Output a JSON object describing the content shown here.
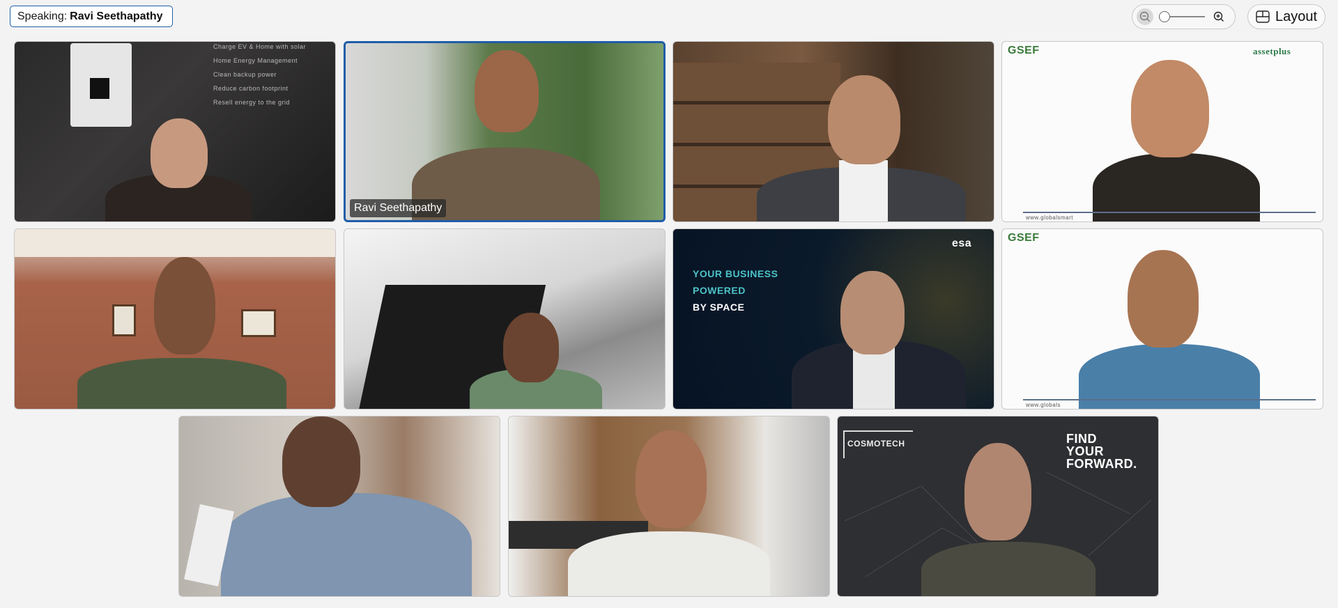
{
  "header": {
    "speaking_prefix": "Speaking:",
    "speaking_name": "Ravi Seethapathy",
    "layout_label": "Layout"
  },
  "tiles": [
    {
      "id": "tile-1",
      "label": "",
      "overlay": [
        "Charge EV & Home with solar",
        "Home Energy Management",
        "Clean backup power",
        "Reduce carbon footprint",
        "Resell energy to the grid"
      ]
    },
    {
      "id": "tile-2",
      "label": "Ravi Seethapathy",
      "active": true
    },
    {
      "id": "tile-3",
      "label": ""
    },
    {
      "id": "tile-4",
      "label": "",
      "logo_left": "GSEF",
      "logo_right": "assetplus",
      "footer": "www.globalsmart"
    },
    {
      "id": "tile-5",
      "label": ""
    },
    {
      "id": "tile-6",
      "label": ""
    },
    {
      "id": "tile-7",
      "label": "",
      "overlay": [
        "YOUR BUSINESS",
        "POWERED",
        "BY SPACE"
      ],
      "logo": "esa"
    },
    {
      "id": "tile-8",
      "label": "",
      "logo_left": "GSEF",
      "footer": "www.globals"
    },
    {
      "id": "tile-9",
      "label": ""
    },
    {
      "id": "tile-10",
      "label": ""
    },
    {
      "id": "tile-11",
      "label": "",
      "logo": "COSMOTECH",
      "overlay": [
        "FIND",
        "YOUR",
        "FORWARD."
      ]
    }
  ],
  "colors": {
    "accent": "#1f5da8",
    "background": "#f3f3f3"
  }
}
